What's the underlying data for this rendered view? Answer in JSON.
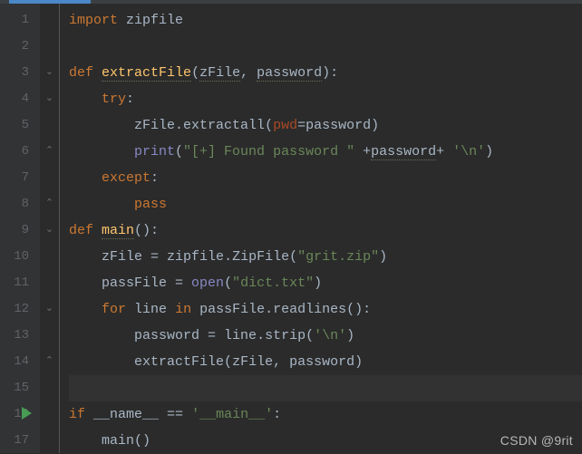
{
  "tab": {
    "active": true
  },
  "gutter": {
    "lines": [
      "1",
      "2",
      "3",
      "4",
      "5",
      "6",
      "7",
      "8",
      "9",
      "10",
      "11",
      "12",
      "13",
      "14",
      "15",
      "16",
      "17"
    ],
    "runLine": 16
  },
  "fold": {
    "marks": {
      "3": "down-start",
      "4": "down-start",
      "6": "up-end",
      "8": "up-end",
      "9": "down-start",
      "12": "down-start",
      "14": "up-end"
    }
  },
  "code": {
    "l1": {
      "kw": "import",
      "mod": "zipfile"
    },
    "l3": {
      "kw": "def",
      "fn": "extractFile",
      "p1": "zFile",
      "p2": "password"
    },
    "l4": {
      "kw": "try",
      "colon": ":"
    },
    "l5": {
      "obj": "zFile",
      "dot": ".",
      "method": "extractall",
      "op": "(",
      "kwarg": "pwd",
      "eq": "=",
      "arg": "password",
      "cp": ")"
    },
    "l6": {
      "fn": "print",
      "op": "(",
      "s1": "\"[+] Found password \"",
      "plus1": " +",
      "var": "password",
      "plus2": "+ ",
      "s2": "'\\n'",
      "cp": ")"
    },
    "l7": {
      "kw": "except",
      "colon": ":"
    },
    "l8": {
      "kw": "pass"
    },
    "l9": {
      "kw": "def",
      "fn": "main",
      "parens": "():"
    },
    "l10": {
      "lhs": "zFile",
      "eq": " = ",
      "mod": "zipfile",
      "dot": ".",
      "cls": "ZipFile",
      "op": "(",
      "s": "\"grit.zip\"",
      "cp": ")"
    },
    "l11": {
      "lhs": "passFile",
      "eq": " = ",
      "fn": "open",
      "op": "(",
      "s": "\"dict.txt\"",
      "cp": ")"
    },
    "l12": {
      "kw": "for",
      "var": "line",
      "kw2": "in",
      "obj": "passFile",
      "dot": ".",
      "method": "readlines",
      "tail": "():"
    },
    "l13": {
      "lhs": "password",
      "eq": " = ",
      "obj": "line",
      "dot": ".",
      "method": "strip",
      "op": "(",
      "s": "'\\n'",
      "cp": ")"
    },
    "l14": {
      "fn": "extractFile",
      "op": "(",
      "a1": "zFile",
      "comma": ", ",
      "a2": "password",
      "cp": ")"
    },
    "l16": {
      "kw": "if",
      "dunder": "__name__",
      "eq": " == ",
      "s": "'__main__'",
      "colon": ":"
    },
    "l17": {
      "fn": "main",
      "parens": "()"
    }
  },
  "watermark": "CSDN @9rit"
}
